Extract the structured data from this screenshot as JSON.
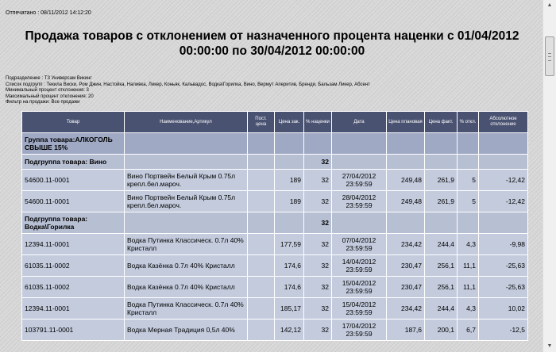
{
  "printed": "Отпечатано : 08/11/2012 14:12:20",
  "title_line1": "Продажа товаров с отклонением от назначенного процента наценки с 01/04/2012",
  "title_line2": "00:00:00 по 30/04/2012 00:00:00",
  "filters": [
    "Подразделение : ТЗ Универсам Викинг",
    "Список подгрупп : Текила Виски, Ром Джин, Настойка, Наливка, Ликер, Коньяк, Кальвадос, Водка\\Горилка, Вино, Вермут Аперитив, Бренди, Бальзам Ликер, Абсент",
    "Минимальный процент отклонения: 3",
    "Максимальный процент отклонения: 20",
    "Фильтр на продажи: Все продажи"
  ],
  "columns": [
    "Товар",
    "Наименование,Артикул",
    "Пост. цена",
    "Цена зак.",
    "% наценки",
    "Дата",
    "Цена плановая",
    "Цена факт.",
    "% откл.",
    "Абсолютное отклонение"
  ],
  "group": {
    "label": "Группа товара:АЛКОГОЛЬ СВЫШЕ 15%"
  },
  "subgroups": [
    {
      "label": "Подгруппа товара: Вино",
      "markup": "32",
      "rows": [
        {
          "code": "54600.11-0001",
          "name": "Вино Портвейн Белый Крым  0.75л крепл.бел.мароч.",
          "post_price": "",
          "purchase_price": "189",
          "markup": "32",
          "date": "27/04/2012 23:59:59",
          "plan_price": "249,48",
          "fact_price": "261,9",
          "dev_pct": "5",
          "abs_dev": "-12,42"
        },
        {
          "code": "54600.11-0001",
          "name": "Вино Портвейн Белый Крым  0.75л крепл.бел.мароч.",
          "post_price": "",
          "purchase_price": "189",
          "markup": "32",
          "date": "28/04/2012 23:59:59",
          "plan_price": "249,48",
          "fact_price": "261,9",
          "dev_pct": "5",
          "abs_dev": "-12,42"
        }
      ]
    },
    {
      "label": "Подгруппа товара: Водка\\Горилка",
      "markup": "32",
      "rows": [
        {
          "code": "12394.11-0001",
          "name": "Водка Путинка Классическ.  0.7л 40% Кристалл",
          "post_price": "",
          "purchase_price": "177,59",
          "markup": "32",
          "date": "07/04/2012 23:59:59",
          "plan_price": "234,42",
          "fact_price": "244,4",
          "dev_pct": "4,3",
          "abs_dev": "-9,98"
        },
        {
          "code": "61035.11-0002",
          "name": "Водка Казёнка  0.7л 40% Кристалл",
          "post_price": "",
          "purchase_price": "174,6",
          "markup": "32",
          "date": "14/04/2012 23:59:59",
          "plan_price": "230,47",
          "fact_price": "256,1",
          "dev_pct": "11,1",
          "abs_dev": "-25,63"
        },
        {
          "code": "61035.11-0002",
          "name": "Водка Казёнка  0.7л 40% Кристалл",
          "post_price": "",
          "purchase_price": "174,6",
          "markup": "32",
          "date": "15/04/2012 23:59:59",
          "plan_price": "230,47",
          "fact_price": "256,1",
          "dev_pct": "11,1",
          "abs_dev": "-25,63"
        },
        {
          "code": "12394.11-0001",
          "name": "Водка Путинка Классическ.  0.7л 40% Кристалл",
          "post_price": "",
          "purchase_price": "185,17",
          "markup": "32",
          "date": "15/04/2012 23:59:59",
          "plan_price": "234,42",
          "fact_price": "244,4",
          "dev_pct": "4,3",
          "abs_dev": "10,02"
        },
        {
          "code": "103791.11-0001",
          "name": "Водка Мерная Традиция  0,5л 40%",
          "post_price": "",
          "purchase_price": "142,12",
          "markup": "32",
          "date": "17/04/2012 23:59:59",
          "plan_price": "187,6",
          "fact_price": "200,1",
          "dev_pct": "6,7",
          "abs_dev": "-12,5"
        }
      ]
    }
  ]
}
